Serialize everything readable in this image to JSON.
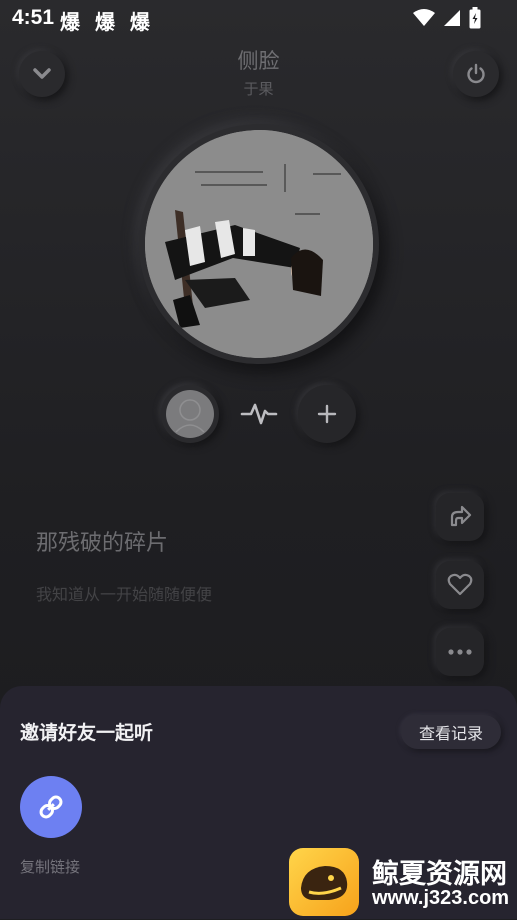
{
  "status_bar": {
    "time": "4:51",
    "extra": "爆 爆 爆"
  },
  "header": {
    "title": "侧脸",
    "artist": "于果"
  },
  "lyrics": {
    "current": "那残破的碎片",
    "next": "我知道从一开始随随便便"
  },
  "invite_sheet": {
    "title": "邀请好友一起听",
    "history_button": "查看记录",
    "copy_link_label": "复制链接"
  },
  "watermark": {
    "name": "鲸夏资源网",
    "url": "www.j323.com"
  },
  "colors": {
    "accent": "#6d80f2",
    "sheet_bg": "#26242f",
    "app_bg": "#1e1e21"
  }
}
